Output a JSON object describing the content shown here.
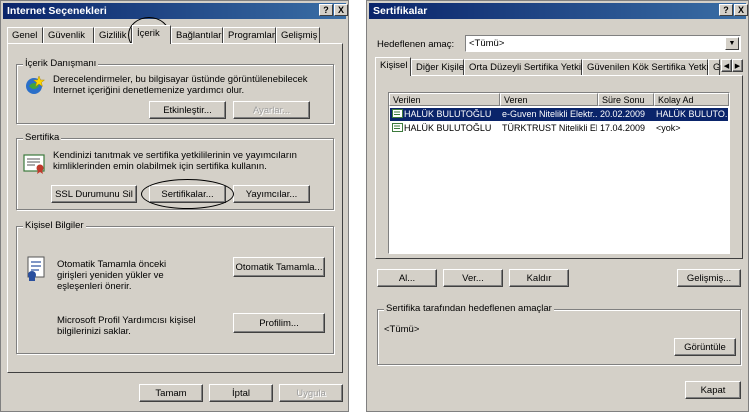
{
  "left_window": {
    "title": "Internet Seçenekleri",
    "title_buttons": [
      "?",
      "X"
    ],
    "tabs": [
      "Genel",
      "Güvenlik",
      "Gizlilik",
      "İçerik",
      "Bağlantılar",
      "Programlar",
      "Gelişmiş"
    ],
    "active_tab": "İçerik",
    "content_advisor": {
      "title": "İçerik Danışmanı",
      "description": "Derecelendirmeler, bu bilgisayar üstünde görüntülenebilecek Internet içeriğini denetlemenize yardımcı olur.",
      "enable_button": "Etkinleştir...",
      "settings_button": "Ayarlar..."
    },
    "certificates": {
      "title": "Sertifika",
      "description": "Kendinizi tanıtmak ve sertifika yetkililerinin ve yayımcıların kimliklerinden emin olabilmek için sertifika kullanın.",
      "ssl_button": "SSL Durumunu Sil",
      "certificates_button": "Sertifikalar...",
      "publishers_button": "Yayımcılar..."
    },
    "personal": {
      "title": "Kişisel Bilgiler",
      "autocomplete_text": "Otomatik Tamamla önceki girişleri yeniden yükler ve eşleşenleri önerir.",
      "autocomplete_button": "Otomatik Tamamla...",
      "profile_text": "Microsoft Profil Yardımcısı kişisel bilgilerinizi saklar.",
      "profile_button": "Profilim..."
    },
    "footer": {
      "ok": "Tamam",
      "cancel": "İptal",
      "apply": "Uygula"
    }
  },
  "right_window": {
    "title": "Sertifikalar",
    "title_buttons": [
      "?",
      "X"
    ],
    "purpose_label": "Hedeflenen amaç:",
    "purpose_value": "<Tümü>",
    "tabs": [
      "Kişisel",
      "Diğer Kişiler",
      "Orta Düzeyli Sertifika Yetkilileri",
      "Güvenilen Kök Sertifika Yetkilileri",
      "Gü"
    ],
    "columns": [
      "Verilen",
      "Veren",
      "Süre Sonu",
      "Kolay Ad"
    ],
    "rows": [
      {
        "issued_to": "HALÜK BULUTOĞLU",
        "issued_by": "e-Guven Nitelikli Elektr...",
        "expires": "20.02.2009",
        "friendly": "HALÜK BULUTO...",
        "selected": true
      },
      {
        "issued_to": "HALÜK BULUTOĞLU",
        "issued_by": "TÜRKTRUST Nitelikli El...",
        "expires": "17.04.2009",
        "friendly": "<yok>",
        "selected": false
      }
    ],
    "buttons": {
      "import": "Al...",
      "export": "Ver...",
      "remove": "Kaldır",
      "advanced": "Gelişmiş..."
    },
    "purposes_group_title": "Sertifika tarafından hedeflenen amaçlar",
    "purposes_value": "<Tümü>",
    "view_button": "Görüntüle",
    "close_button": "Kapat"
  }
}
